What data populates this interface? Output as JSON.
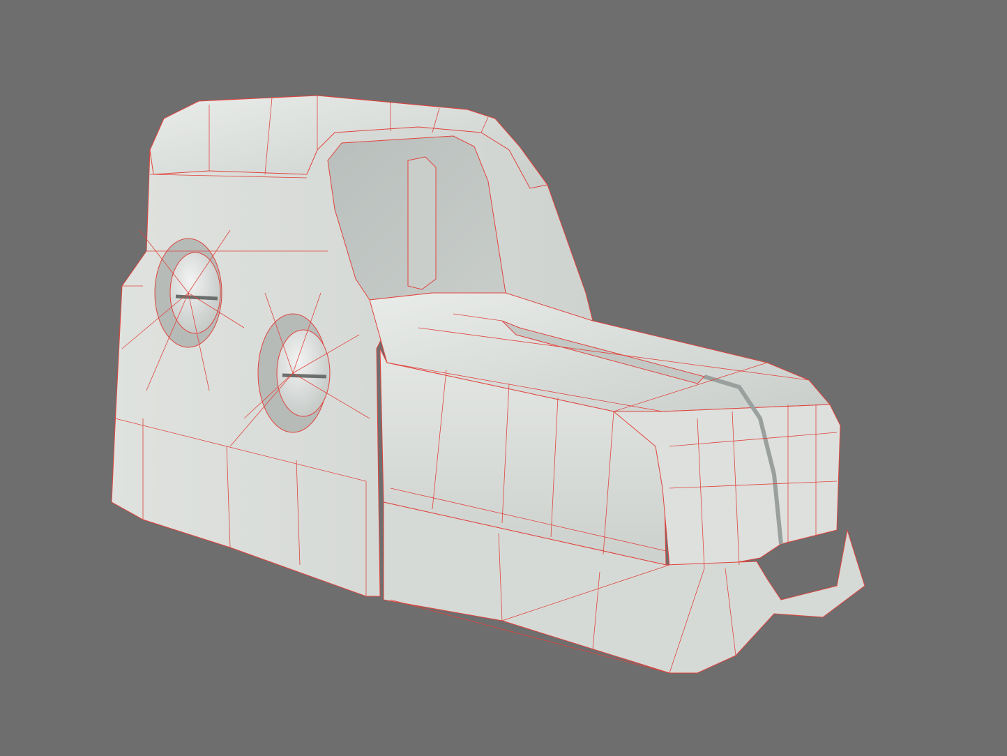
{
  "viewport": {
    "background": "#6e6e6e",
    "model": {
      "name": "holographic-sight-model",
      "render_mode": "wireframe-on-shaded",
      "surface_color": "#d9dcd8",
      "wire_color": "#e0443e",
      "shadow_color": "#b7bbb8",
      "highlight_color": "#eef0ee"
    }
  }
}
